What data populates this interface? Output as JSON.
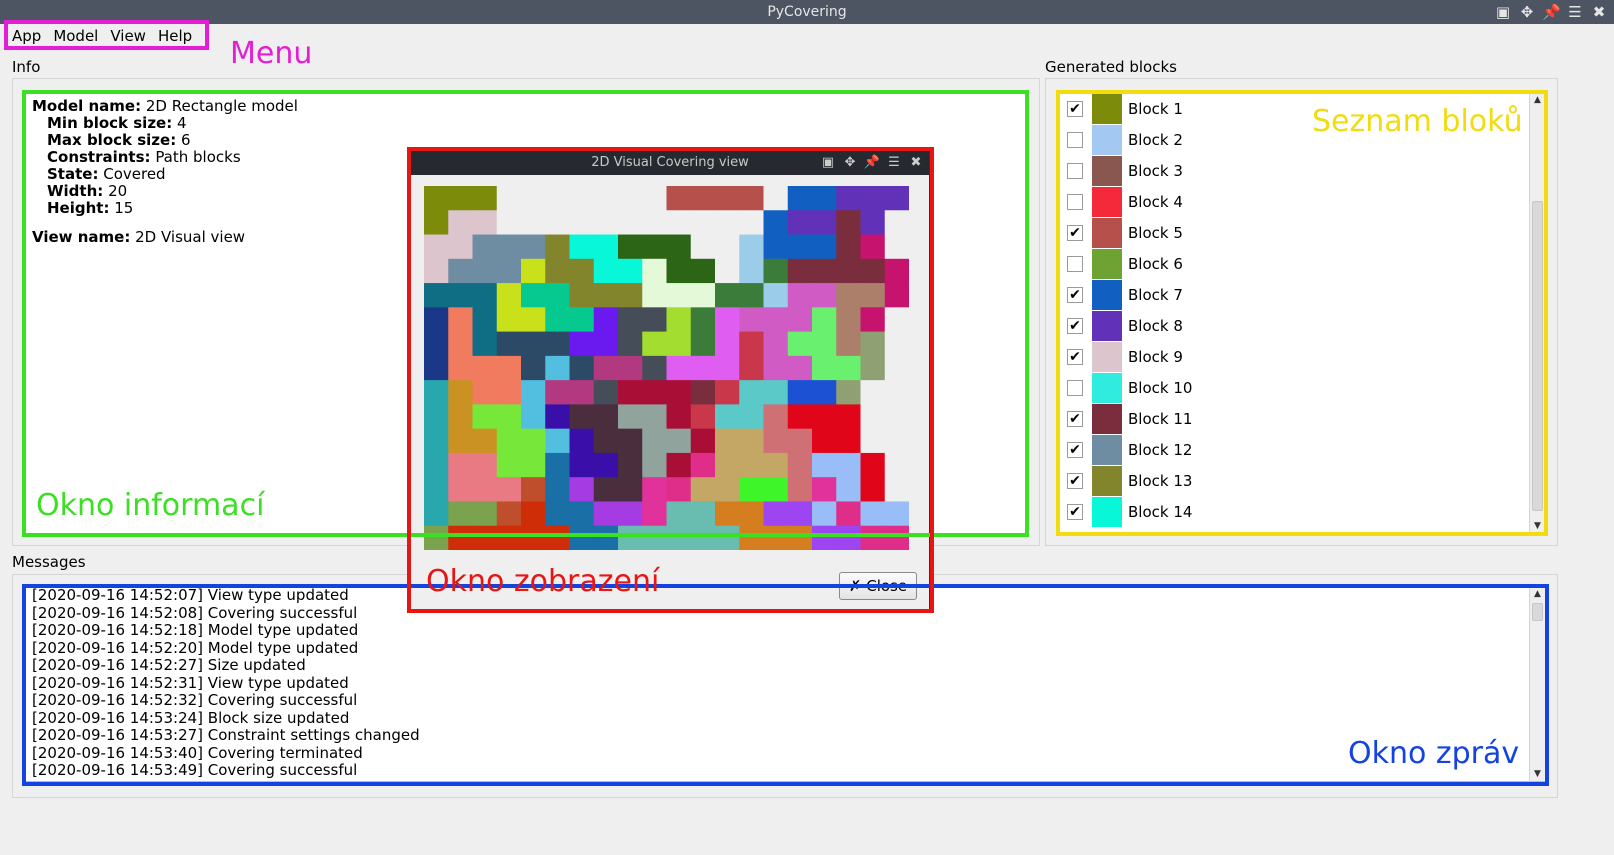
{
  "window": {
    "title": "PyCovering"
  },
  "menu": {
    "items": [
      "App",
      "Model",
      "View",
      "Help"
    ]
  },
  "info": {
    "group_label": "Info",
    "model_name_label": "Model name:",
    "model_name": "2D Rectangle model",
    "min_label": "Min block size:",
    "min": "4",
    "max_label": "Max block size:",
    "max": "6",
    "constraints_label": "Constraints:",
    "constraints": "Path blocks",
    "state_label": "State:",
    "state": "Covered",
    "width_label": "Width:",
    "width": "20",
    "height_label": "Height:",
    "height": "15",
    "view_name_label": "View name:",
    "view_name": "2D Visual view"
  },
  "blocks": {
    "group_label": "Generated blocks",
    "items": [
      {
        "label": "Block 1",
        "checked": true,
        "color": "#7c8b0a"
      },
      {
        "label": "Block 2",
        "checked": false,
        "color": "#a3c9f3"
      },
      {
        "label": "Block 3",
        "checked": false,
        "color": "#8a5750"
      },
      {
        "label": "Block 4",
        "checked": false,
        "color": "#f42a3a"
      },
      {
        "label": "Block 5",
        "checked": true,
        "color": "#b5504a"
      },
      {
        "label": "Block 6",
        "checked": false,
        "color": "#6ea232"
      },
      {
        "label": "Block 7",
        "checked": true,
        "color": "#1160c1"
      },
      {
        "label": "Block 8",
        "checked": true,
        "color": "#6132b8"
      },
      {
        "label": "Block 9",
        "checked": true,
        "color": "#dcc5cc"
      },
      {
        "label": "Block 10",
        "checked": false,
        "color": "#30ecdf"
      },
      {
        "label": "Block 11",
        "checked": true,
        "color": "#7a2d3c"
      },
      {
        "label": "Block 12",
        "checked": true,
        "color": "#6e8da2"
      },
      {
        "label": "Block 13",
        "checked": true,
        "color": "#82852c"
      },
      {
        "label": "Block 14",
        "checked": true,
        "color": "#07f7d8"
      }
    ]
  },
  "messages": {
    "group_label": "Messages",
    "lines": [
      "[2020-09-16 14:52:07] View type updated",
      "[2020-09-16 14:52:08] Covering successful",
      "[2020-09-16 14:52:18] Model type updated",
      "[2020-09-16 14:52:20] Model type updated",
      "[2020-09-16 14:52:27] Size updated",
      "[2020-09-16 14:52:31] View type updated",
      "[2020-09-16 14:52:32] Covering successful",
      "[2020-09-16 14:53:24] Block size updated",
      "[2020-09-16 14:53:27] Constraint settings changed",
      "[2020-09-16 14:53:40] Covering terminated",
      "[2020-09-16 14:53:49] Covering successful"
    ]
  },
  "dialog": {
    "title": "2D Visual Covering view",
    "close_label": "Close"
  },
  "annotations": {
    "menu": {
      "text": "Menu",
      "color": "#e31ed4"
    },
    "info": {
      "text": "Okno informací",
      "color": "#3be024"
    },
    "blocks": {
      "text": "Seznam bloků",
      "color": "#f2dc10"
    },
    "view": {
      "text": "Okno zobrazení",
      "color": "#e81515"
    },
    "messages": {
      "text": "Okno zpráv",
      "color": "#1443e0"
    }
  },
  "grid": {
    "cols": 20,
    "rows": 15,
    "palette": {
      "A": "#7c8b0a",
      "B": "#dcc5cc",
      "C": "#b5504a",
      "D": "#1160c1",
      "E": "#6132b8",
      "F": "#6e8da2",
      "G": "#82852c",
      "H": "#07f7d8",
      "I": "#2d6517",
      "J": "#9bcdea",
      "K": "#c8e11b",
      "L": "#e4f9d8",
      "M": "#3c7c3a",
      "N": "#7a2d3c",
      "O": "#c6136d",
      "P": "#0f6e83",
      "Q": "#06c990",
      "R": "#df5ef1",
      "S": "#d05bc4",
      "T": "#ac7f6a",
      "U": "#1b3888",
      "V": "#f17b5e",
      "W": "#2c4a66",
      "X": "#6a19ef",
      "Y": "#454d59",
      "Z": "#a2dd30",
      "a": "#c8374a",
      "b": "#68f06e",
      "c": "#8fa173",
      "d": "#52bfe0",
      "e": "#b23880",
      "f": "#3d9ee8",
      "g": "#a90f36",
      "h": "#5bc9c8",
      "i": "#1d51d3",
      "j": "#28a8ad",
      "k": "#c99222",
      "l": "#77e83a",
      "m": "#3a0fa9",
      "n": "#4b2e3d",
      "o": "#91a39d",
      "p": "#c4a764",
      "q": "#cf7075",
      "r": "#e1051a",
      "s": "#e97983",
      "t": "#bf4e2c",
      "u": "#1a6fa7",
      "v": "#a43be3",
      "w": "#e1319a",
      "x": "#3ef52a",
      "y": "#99bdf6",
      "z": "#d57e20",
      "0": "#cf2c08",
      "1": "#69bcb0",
      "2": "#9c45f0",
      "3": "#de2e8a",
      "4": "#7ba24e",
      "5": "#4a8e6c",
      "6": "#ca3064",
      "7": "#3f3f85",
      "8": "#f4d0c7",
      "9": "#8ac47a",
      ".": "#efefef"
    },
    "cells": [
      "AAA.......CCCC.DDEEE",
      "ABB...........DEENE",
      "BBFFFGHHIII..JDDDNO",
      "BFFFKGGHHLII.JMNNNNO",
      "PPPKQQGGGLLLMMJSSTTO",
      "UVPKKQQXYYZMRSSSbTO",
      "UVPWWWXXYZZMRaSbbTc",
      "UVVVWdWeeYRRRaSSbbc",
      "jkVVdeeYgggNahhiic",
      "jklldmnnoogahhqrrr",
      "jkklldmnnoogppqqrr",
      "jssllummnog3pppqyyr",
      "jssstuvnnw3ppxxqwyr",
      "j44t0uuvvw11zz22y3yy",
      "400000uu11111zzz22333"
    ]
  }
}
